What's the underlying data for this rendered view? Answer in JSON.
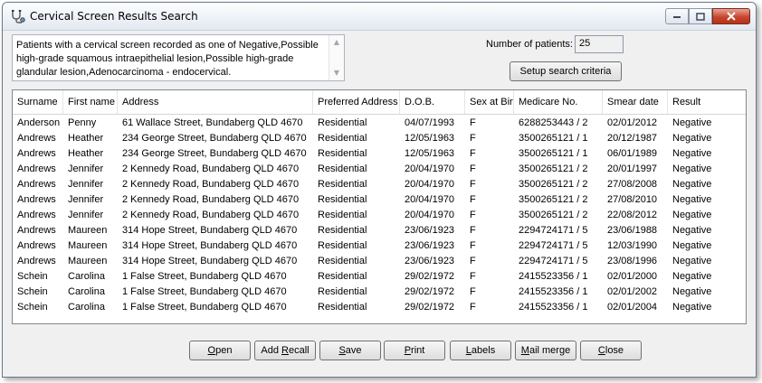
{
  "window": {
    "title": "Cervical Screen Results Search",
    "title_icon": "stethoscope-icon",
    "controls": {
      "minimize": "minimize-icon",
      "maximize": "maximize-icon",
      "close": "close-icon"
    }
  },
  "criteria": {
    "text": "Patients with a cervical screen recorded as one of  Negative,Possible high-grade squamous intraepithelial lesion,Possible high-grade glandular lesion,Adenocarcinoma - endocervical."
  },
  "patient_count": {
    "label": "Number of patients:",
    "value": "25"
  },
  "setup_button": "Setup search criteria",
  "table": {
    "columns": [
      "Surname",
      "First name",
      "Address",
      "Preferred Address",
      "D.O.B.",
      "Sex at Birt",
      "Medicare No.",
      "Smear date",
      "Result"
    ],
    "rows": [
      [
        "Anderson",
        "Penny",
        "61 Wallace Street,  Bundaberg  QLD 4670",
        "Residential",
        "04/07/1993",
        "F",
        "6288253443 / 2",
        "02/01/2012",
        "Negative"
      ],
      [
        "Andrews",
        "Heather",
        "234 George Street,  Bundaberg  QLD 4670",
        "Residential",
        "12/05/1963",
        "F",
        "3500265121 / 1",
        "20/12/1987",
        "Negative"
      ],
      [
        "Andrews",
        "Heather",
        "234 George Street,  Bundaberg  QLD 4670",
        "Residential",
        "12/05/1963",
        "F",
        "3500265121 / 1",
        "06/01/1989",
        "Negative"
      ],
      [
        "Andrews",
        "Jennifer",
        "2 Kennedy Road,  Bundaberg  QLD 4670",
        "Residential",
        "20/04/1970",
        "F",
        "3500265121 / 2",
        "20/01/1997",
        "Negative"
      ],
      [
        "Andrews",
        "Jennifer",
        "2 Kennedy Road,  Bundaberg  QLD 4670",
        "Residential",
        "20/04/1970",
        "F",
        "3500265121 / 2",
        "27/08/2008",
        "Negative"
      ],
      [
        "Andrews",
        "Jennifer",
        "2 Kennedy Road,  Bundaberg  QLD 4670",
        "Residential",
        "20/04/1970",
        "F",
        "3500265121 / 2",
        "27/08/2010",
        "Negative"
      ],
      [
        "Andrews",
        "Jennifer",
        "2 Kennedy Road,  Bundaberg  QLD 4670",
        "Residential",
        "20/04/1970",
        "F",
        "3500265121 / 2",
        "22/08/2012",
        "Negative"
      ],
      [
        "Andrews",
        "Maureen",
        "314 Hope Street,  Bundaberg  QLD 4670",
        "Residential",
        "23/06/1923",
        "F",
        "2294724171 / 5",
        "23/06/1988",
        "Negative"
      ],
      [
        "Andrews",
        "Maureen",
        "314 Hope Street,  Bundaberg  QLD 4670",
        "Residential",
        "23/06/1923",
        "F",
        "2294724171 / 5",
        "12/03/1990",
        "Negative"
      ],
      [
        "Andrews",
        "Maureen",
        "314 Hope Street,  Bundaberg  QLD 4670",
        "Residential",
        "23/06/1923",
        "F",
        "2294724171 / 5",
        "23/08/1996",
        "Negative"
      ],
      [
        "Schein",
        "Carolina",
        "1 False Street,  Bundaberg  QLD 4670",
        "Residential",
        "29/02/1972",
        "F",
        "2415523356 / 1",
        "02/01/2000",
        "Negative"
      ],
      [
        "Schein",
        "Carolina",
        "1 False Street,  Bundaberg  QLD 4670",
        "Residential",
        "29/02/1972",
        "F",
        "2415523356 / 1",
        "02/01/2002",
        "Negative"
      ],
      [
        "Schein",
        "Carolina",
        "1 False Street,  Bundaberg  QLD 4670",
        "Residential",
        "29/02/1972",
        "F",
        "2415523356 / 1",
        "02/01/2004",
        "Negative"
      ]
    ]
  },
  "buttons": {
    "open": {
      "label": "Open",
      "accel": "O",
      "rest": "pen"
    },
    "add_recall": {
      "label": "Add Recall",
      "pre": "Add ",
      "accel": "R",
      "rest": "ecall"
    },
    "save": {
      "label": "Save",
      "accel": "S",
      "rest": "ave"
    },
    "print": {
      "label": "Print",
      "accel": "P",
      "rest": "rint"
    },
    "labels": {
      "label": "Labels",
      "accel": "L",
      "rest": "abels"
    },
    "mail_merge": {
      "label": "Mail merge",
      "accel": "M",
      "rest": "ail merge"
    },
    "close": {
      "label": "Close",
      "accel": "C",
      "rest": "lose"
    }
  }
}
